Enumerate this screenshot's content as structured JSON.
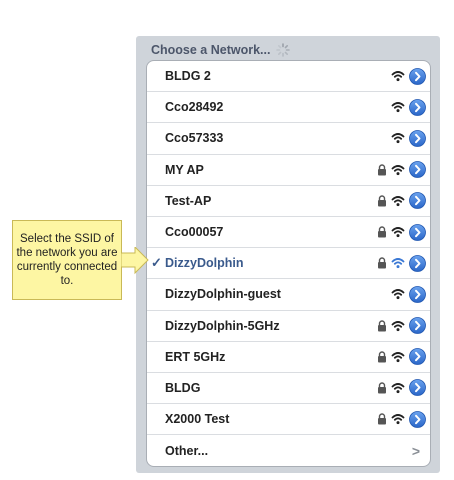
{
  "header": {
    "title": "Choose a Network..."
  },
  "networks": [
    {
      "name": "BLDG 2",
      "locked": false,
      "selected": false
    },
    {
      "name": "Cco28492",
      "locked": false,
      "selected": false
    },
    {
      "name": "Cco57333",
      "locked": false,
      "selected": false
    },
    {
      "name": "MY AP",
      "locked": true,
      "selected": false
    },
    {
      "name": "Test-AP",
      "locked": true,
      "selected": false
    },
    {
      "name": "Cco00057",
      "locked": true,
      "selected": false
    },
    {
      "name": "DizzyDolphin",
      "locked": true,
      "selected": true
    },
    {
      "name": "DizzyDolphin-guest",
      "locked": false,
      "selected": false
    },
    {
      "name": "DizzyDolphin-5GHz",
      "locked": true,
      "selected": false
    },
    {
      "name": "ERT 5GHz",
      "locked": true,
      "selected": false
    },
    {
      "name": "BLDG",
      "locked": true,
      "selected": false
    },
    {
      "name": "X2000 Test",
      "locked": true,
      "selected": false
    }
  ],
  "other": {
    "label": "Other...",
    "chevron": ">"
  },
  "checkmark": "✓",
  "callout": {
    "text": "Select the SSID of the network you are currently connected to."
  },
  "icons": {
    "lock": "lock-icon",
    "wifi": "wifi-icon",
    "detail": "detail-disclosure-icon",
    "spinner": "spinner-icon"
  },
  "colors": {
    "accent": "#3a78d4",
    "selected_text": "#3a5a8c",
    "callout_bg": "#fdf6a3",
    "panel_bg": "#cfd4da"
  }
}
